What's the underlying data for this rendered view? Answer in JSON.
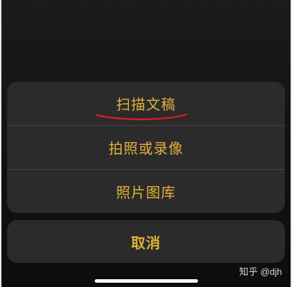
{
  "action_sheet": {
    "items": [
      {
        "label": "扫描文稿"
      },
      {
        "label": "拍照或录像"
      },
      {
        "label": "照片图库"
      }
    ],
    "cancel_label": "取消",
    "accent_color": "#e2b13a",
    "annotation_color": "#e01b1b"
  },
  "watermark": {
    "text": "知乎 @djh"
  }
}
